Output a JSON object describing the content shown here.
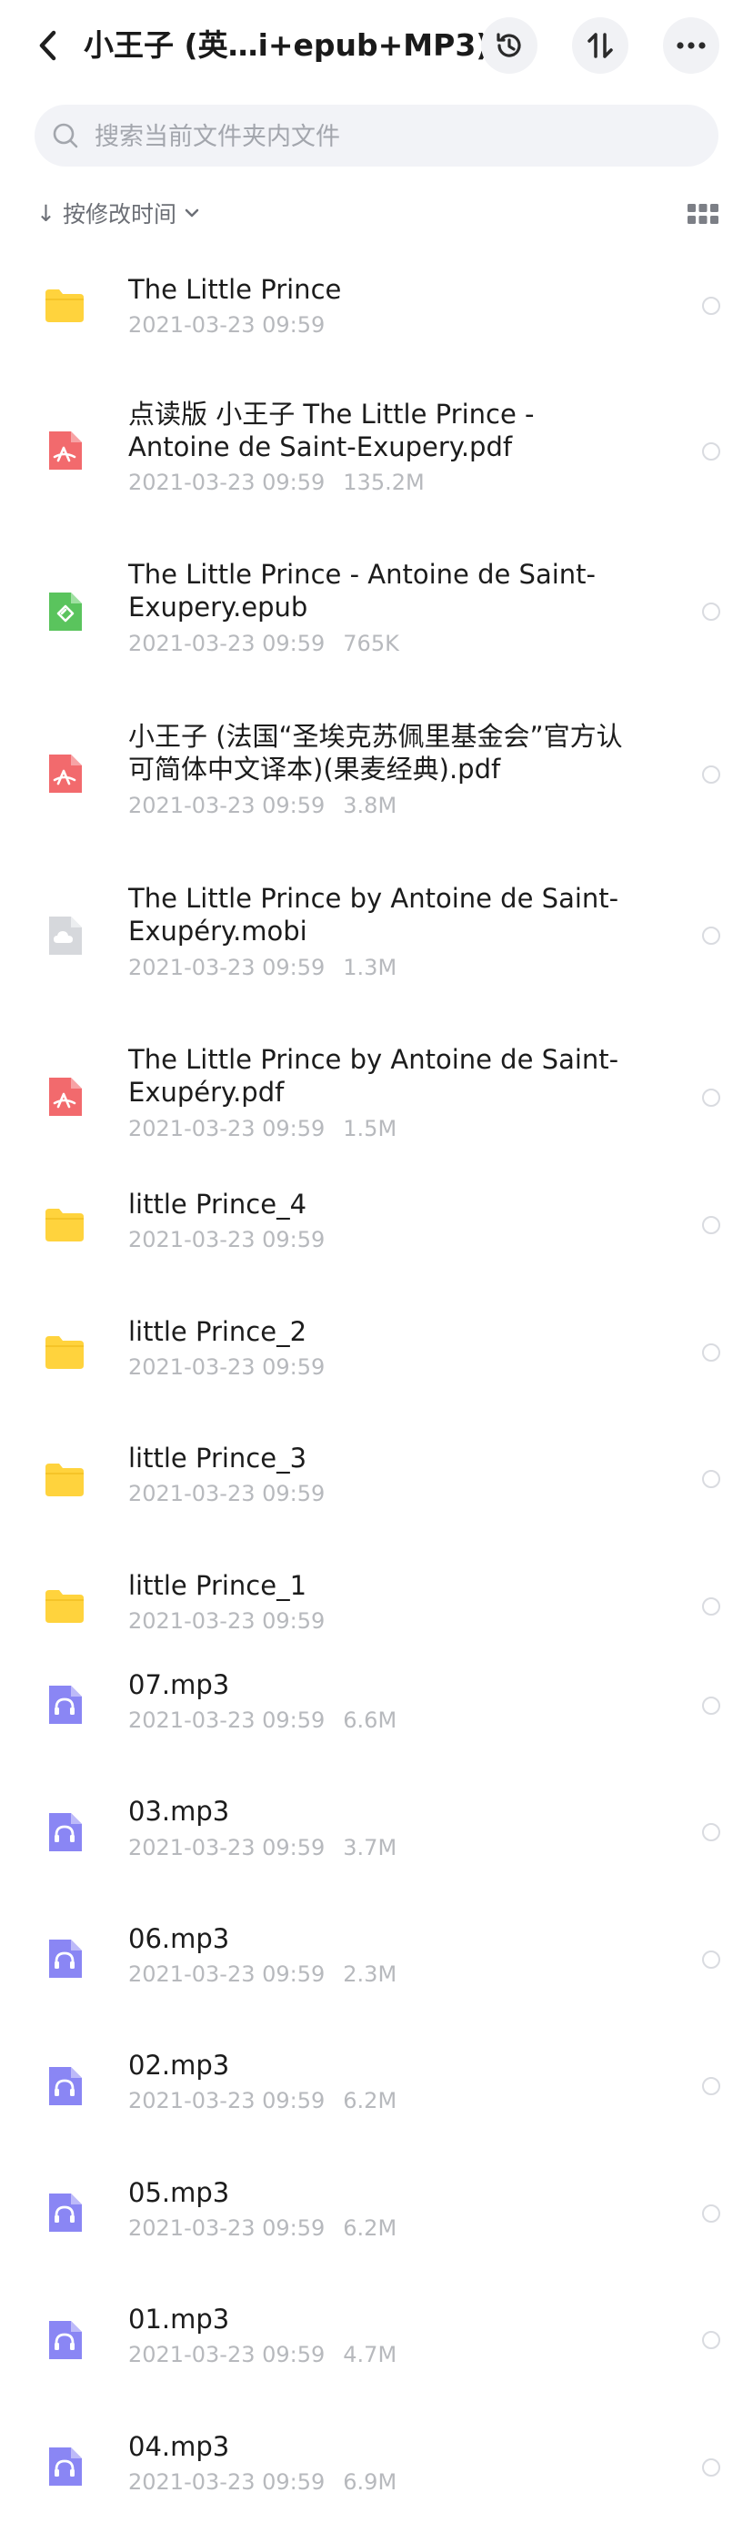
{
  "header": {
    "title": "小王子 (英…i+epub+MP3)",
    "back_icon": "chevron-left-icon",
    "history_icon": "history-icon",
    "sort_icon": "sort-arrows-icon",
    "more_icon": "more-horizontal-icon"
  },
  "search": {
    "placeholder": "搜索当前文件夹内文件",
    "value": ""
  },
  "sort": {
    "label": "按修改时间",
    "arrow": "↓"
  },
  "colors": {
    "folder": "#ffd33d",
    "pdf": "#f26a6d",
    "epub": "#5ac45d",
    "mobi": "#d6d8dc",
    "audio": "#8a86f4"
  },
  "files": [
    {
      "type": "folder",
      "name": "The Little Prince",
      "date": "2021-03-23 09:59",
      "size": ""
    },
    {
      "type": "pdf",
      "name": "点读版 小王子 The Little Prince - Antoine de Saint-Exupery.pdf",
      "date": "2021-03-23 09:59",
      "size": "135.2M"
    },
    {
      "type": "epub",
      "name": "The Little Prince - Antoine de Saint-Exupery.epub",
      "date": "2021-03-23 09:59",
      "size": "765K"
    },
    {
      "type": "pdf",
      "name": "小王子 (法国“圣埃克苏佩里基金会”官方认可简体中文译本)(果麦经典).pdf",
      "date": "2021-03-23 09:59",
      "size": "3.8M"
    },
    {
      "type": "mobi",
      "name": "The Little Prince by Antoine de Saint-Exupéry.mobi",
      "date": "2021-03-23 09:59",
      "size": "1.3M"
    },
    {
      "type": "pdf",
      "name": "The Little Prince by Antoine de Saint-Exupéry.pdf",
      "date": "2021-03-23 09:59",
      "size": "1.5M"
    },
    {
      "type": "folder",
      "name": "little Prince_4",
      "date": "2021-03-23 09:59",
      "size": ""
    },
    {
      "type": "folder",
      "name": "little Prince_2",
      "date": "2021-03-23 09:59",
      "size": ""
    },
    {
      "type": "folder",
      "name": "little Prince_3",
      "date": "2021-03-23 09:59",
      "size": ""
    },
    {
      "type": "folder",
      "name": "little Prince_1",
      "date": "2021-03-23 09:59",
      "size": ""
    },
    {
      "type": "audio",
      "name": "07.mp3",
      "date": "2021-03-23 09:59",
      "size": "6.6M"
    },
    {
      "type": "audio",
      "name": "03.mp3",
      "date": "2021-03-23 09:59",
      "size": "3.7M"
    },
    {
      "type": "audio",
      "name": "06.mp3",
      "date": "2021-03-23 09:59",
      "size": "2.3M"
    },
    {
      "type": "audio",
      "name": "02.mp3",
      "date": "2021-03-23 09:59",
      "size": "6.2M"
    },
    {
      "type": "audio",
      "name": "05.mp3",
      "date": "2021-03-23 09:59",
      "size": "6.2M"
    },
    {
      "type": "audio",
      "name": "01.mp3",
      "date": "2021-03-23 09:59",
      "size": "4.7M"
    },
    {
      "type": "audio",
      "name": "04.mp3",
      "date": "2021-03-23 09:59",
      "size": "6.9M"
    }
  ]
}
